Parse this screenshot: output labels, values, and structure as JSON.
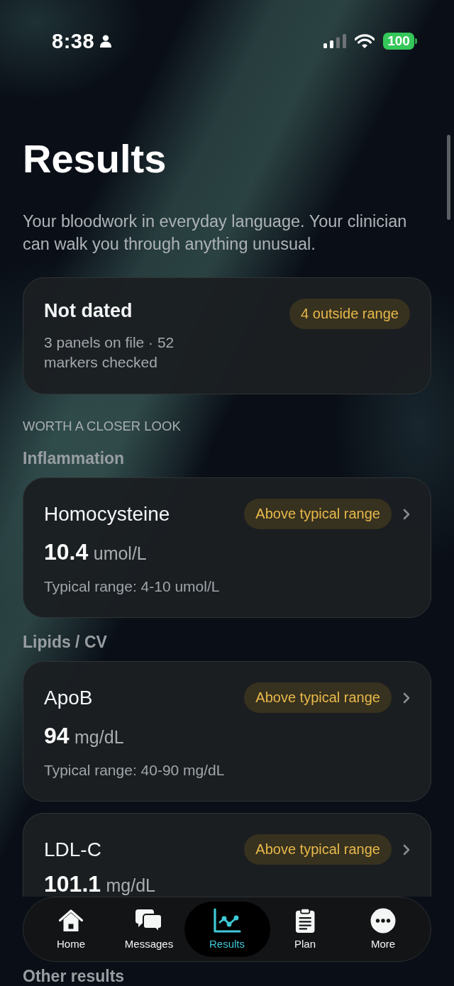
{
  "status_bar": {
    "time": "8:38",
    "battery": "100"
  },
  "header": {
    "title": "Results",
    "subtitle": "Your bloodwork in everyday language. Your clinician can walk you through anything unusual."
  },
  "summary": {
    "title": "Not dated",
    "badge": "4 outside range",
    "details": "3 panels on file · 52 markers checked"
  },
  "section_label": "WORTH A CLOSER LOOK",
  "groups": [
    {
      "title": "Inflammation",
      "results": [
        {
          "name": "Homocysteine",
          "badge": "Above typical range",
          "value": "10.4",
          "unit": "umol/L",
          "range": "Typical range: 4-10 umol/L"
        }
      ]
    },
    {
      "title": "Lipids / CV",
      "results": [
        {
          "name": "ApoB",
          "badge": "Above typical range",
          "value": "94",
          "unit": "mg/dL",
          "range": "Typical range: 40-90 mg/dL"
        },
        {
          "name": "LDL-C",
          "badge": "Above typical range",
          "value": "101.1",
          "unit": "mg/dL"
        }
      ]
    }
  ],
  "next_section": {
    "title": "Other results"
  },
  "tab_bar": {
    "tabs": [
      {
        "label": "Home",
        "selected": false
      },
      {
        "label": "Messages",
        "selected": false
      },
      {
        "label": "Results",
        "selected": true
      },
      {
        "label": "Plan",
        "selected": false
      },
      {
        "label": "More",
        "selected": false
      }
    ]
  }
}
